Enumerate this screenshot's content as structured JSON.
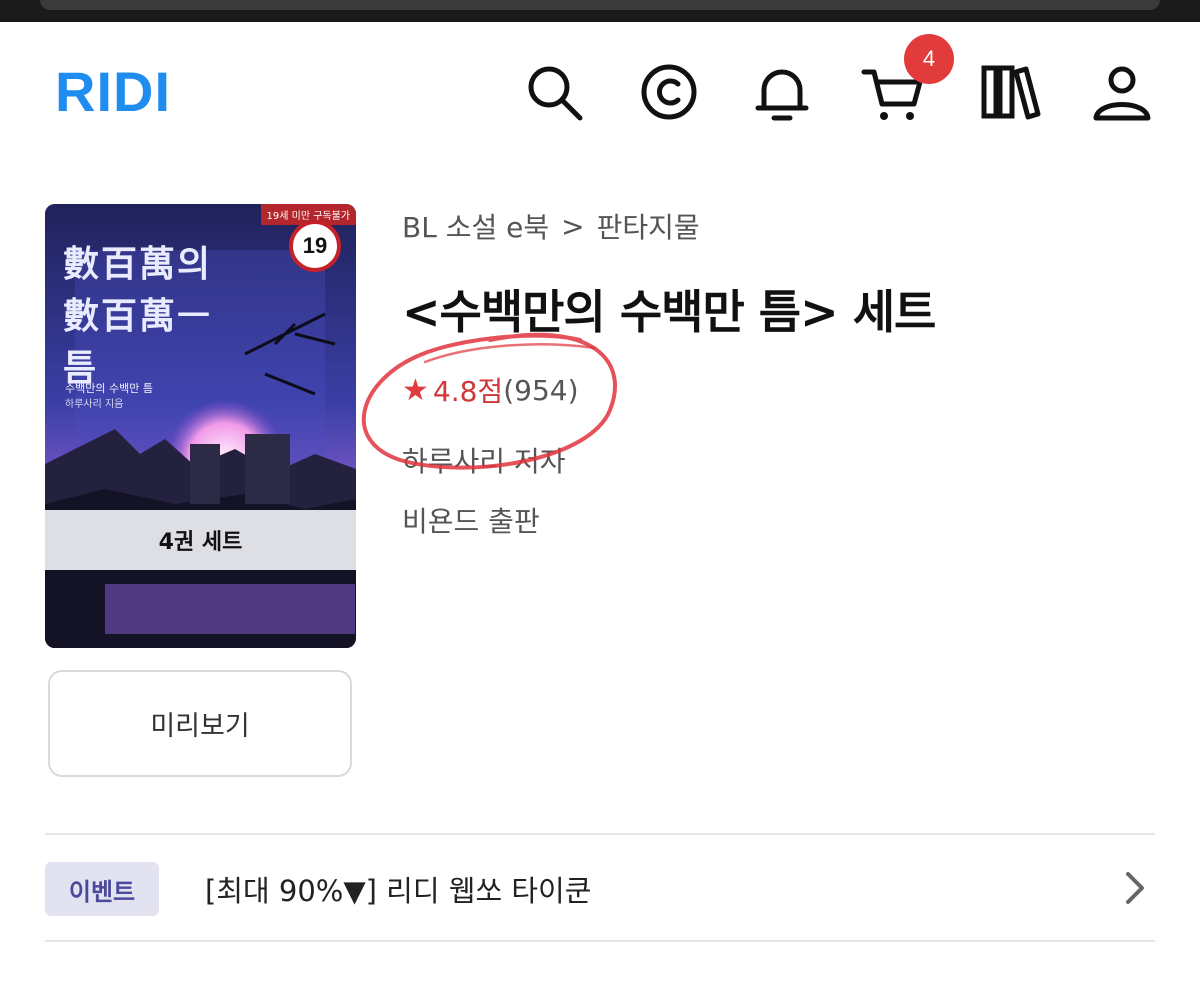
{
  "header": {
    "logo": "RIDI",
    "brand_color": "#1f8cf0",
    "icons": [
      "search-icon",
      "cash-icon",
      "bell-icon",
      "cart-icon",
      "library-icon",
      "user-icon"
    ],
    "cart_count": "4"
  },
  "book": {
    "cover": {
      "age_label": "19세 미만 구독불가",
      "age_badge": "19",
      "title_line1": "數百萬의",
      "title_line2": "數百萬ㅡ",
      "title_line3": "틈",
      "subtitle": "수백만의 수백만 틈",
      "author": "하루사리 지음",
      "set_label": "4권 세트"
    },
    "breadcrumb": {
      "category": "BL 소설 e북",
      "separator": ">",
      "subcategory": "판타지물"
    },
    "title": "<수백만의 수백만 틈> 세트",
    "rating": {
      "score": "4.8점",
      "count": "(954)",
      "color": "#d1363a"
    },
    "author": "하루사리 저자",
    "publisher": "비욘드 출판"
  },
  "preview_button": "미리보기",
  "event": {
    "tag": "이벤트",
    "text": "[최대 90%▼] 리디 웹쏘 타이쿤"
  }
}
